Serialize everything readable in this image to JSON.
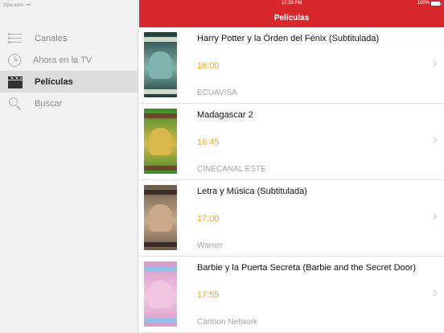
{
  "status": {
    "carrier": "Operador",
    "time": "12:39 PM",
    "battery": "100%"
  },
  "header": {
    "title": "Películas"
  },
  "sidebar": {
    "items": [
      {
        "label": "Canales",
        "icon": "list-icon",
        "active": false
      },
      {
        "label": "Ahora en la TV",
        "icon": "clock-icon",
        "active": false
      },
      {
        "label": "Películas",
        "icon": "clapperboard-icon",
        "active": true
      },
      {
        "label": "Buscar",
        "icon": "search-icon",
        "active": false
      }
    ]
  },
  "movies": [
    {
      "title": "Harry Potter y la Órden del Fénix (Subtitulada)",
      "time": "16:00",
      "channel": "ECUAVISA",
      "poster_colors": [
        "#1f3a3a",
        "#7fb3ad",
        "#cfd9c8"
      ]
    },
    {
      "title": "Madagascar 2",
      "time": "16:45",
      "channel": "CINECANAL ESTE",
      "poster_colors": [
        "#3a8a2a",
        "#d8b84a",
        "#6a4a2a"
      ]
    },
    {
      "title": "Letra y Música (Subtitulada)",
      "time": "17:00",
      "channel": "Warner",
      "poster_colors": [
        "#6a5a4a",
        "#c9a98a",
        "#3a2e28"
      ]
    },
    {
      "title": "Barbie y la Puerta Secreta (Barbie and the Secret Door)",
      "time": "17:55",
      "channel": "Cartoon Network",
      "poster_colors": [
        "#d99ac8",
        "#f2c6e2",
        "#8fc0e8"
      ]
    }
  ],
  "colors": {
    "accent": "#d9272e",
    "time": "#f0a41a"
  }
}
